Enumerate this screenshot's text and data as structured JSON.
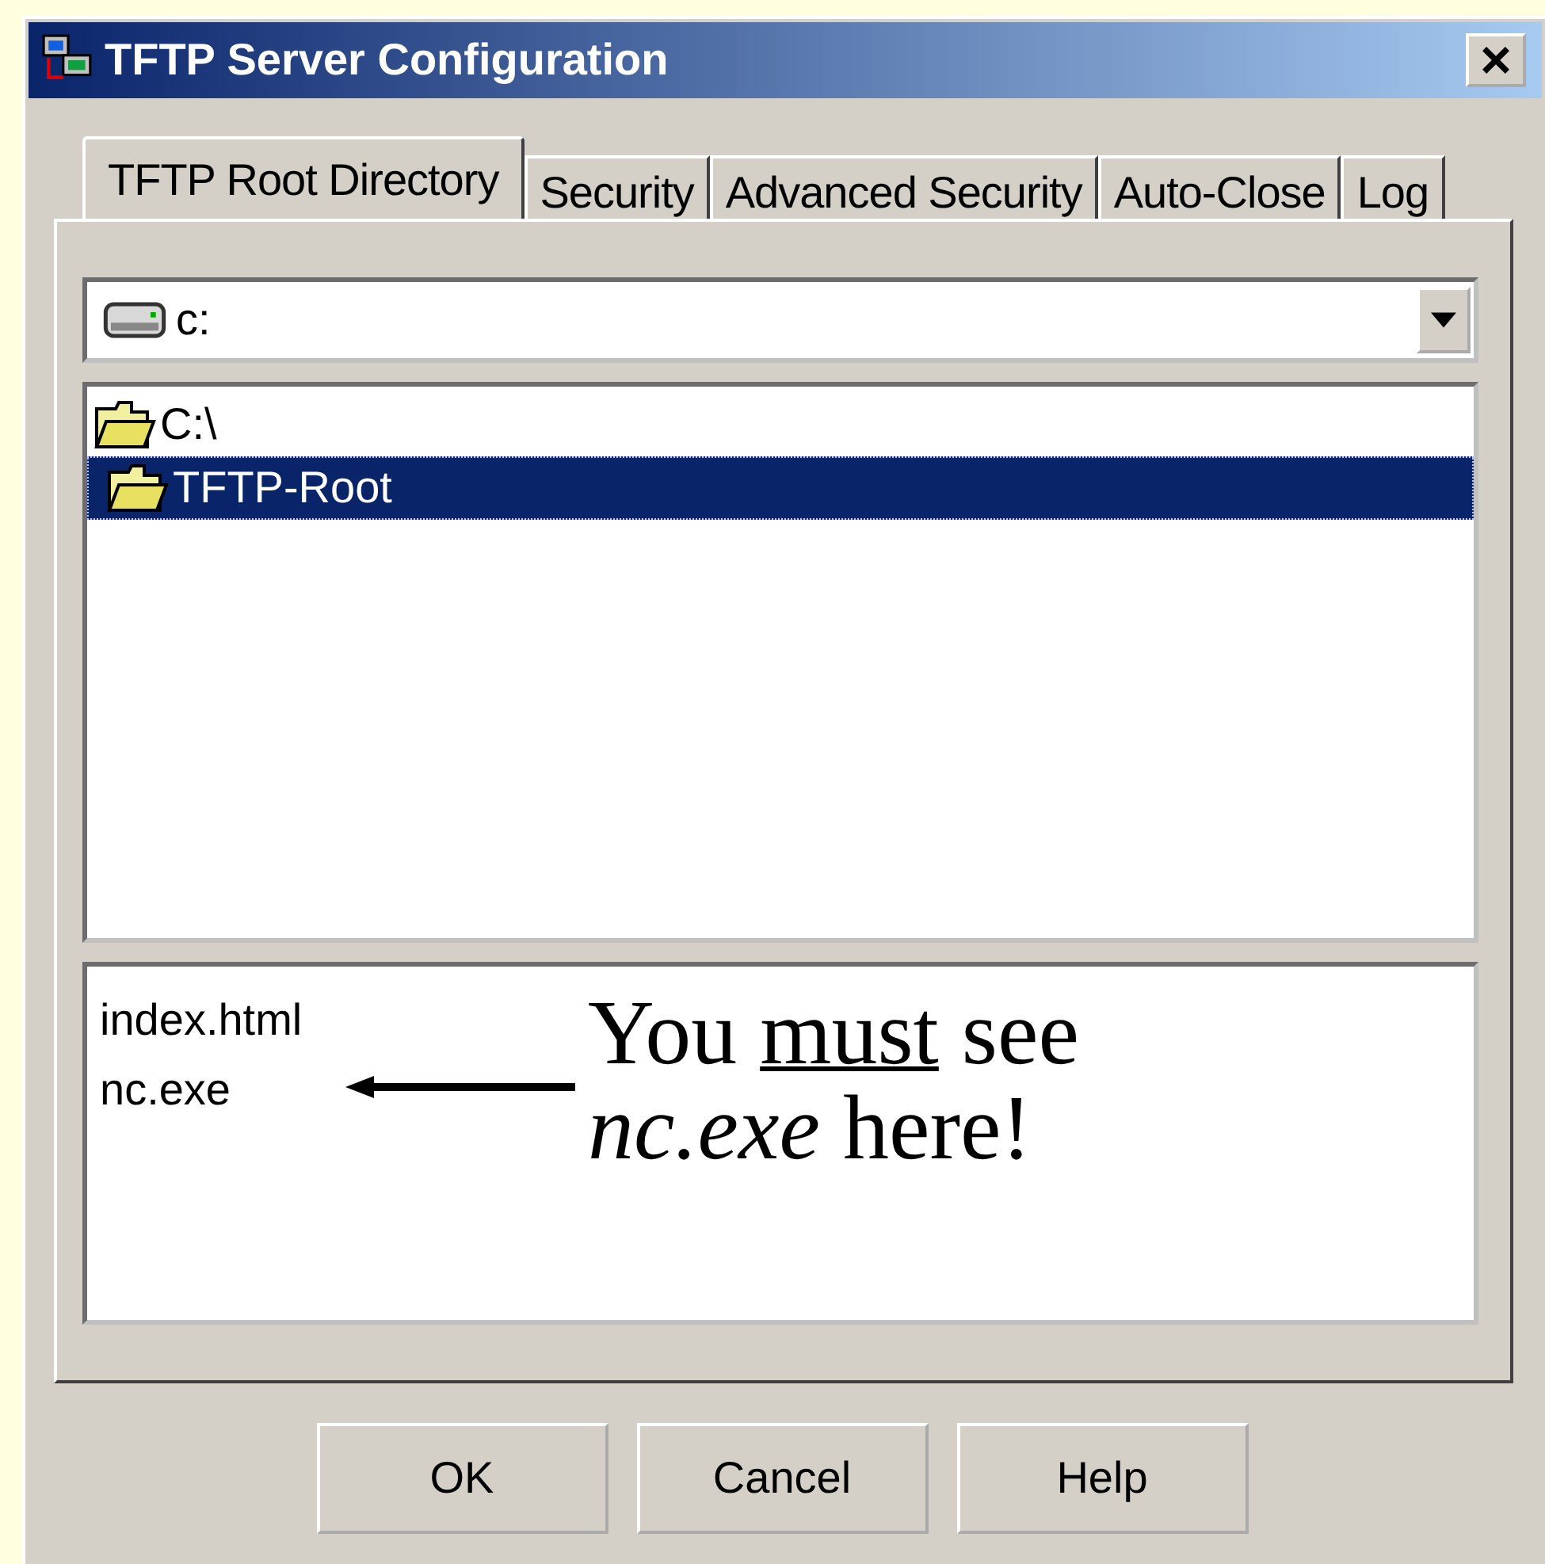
{
  "window": {
    "title": "TFTP Server Configuration"
  },
  "tabs": [
    {
      "label": "TFTP Root Directory",
      "selected": true
    },
    {
      "label": "Security",
      "selected": false
    },
    {
      "label": "Advanced Security",
      "selected": false
    },
    {
      "label": "Auto-Close",
      "selected": false
    },
    {
      "label": "Log",
      "selected": false
    }
  ],
  "drive_dropdown": {
    "value": "c:"
  },
  "folder_tree": [
    {
      "label": "C:\\",
      "selected": false,
      "children": [
        {
          "label": "TFTP-Root",
          "selected": true
        }
      ]
    }
  ],
  "files": [
    "index.html",
    "nc.exe"
  ],
  "annotation": {
    "lines": [
      [
        {
          "text": "You ",
          "underlined": false
        },
        {
          "text": "must",
          "underlined": true
        },
        {
          "text": " see",
          "underlined": false
        }
      ],
      [
        {
          "text": "*nc.exe* here!",
          "underlined": false
        }
      ]
    ]
  },
  "buttons": [
    "OK",
    "Cancel",
    "Help"
  ]
}
